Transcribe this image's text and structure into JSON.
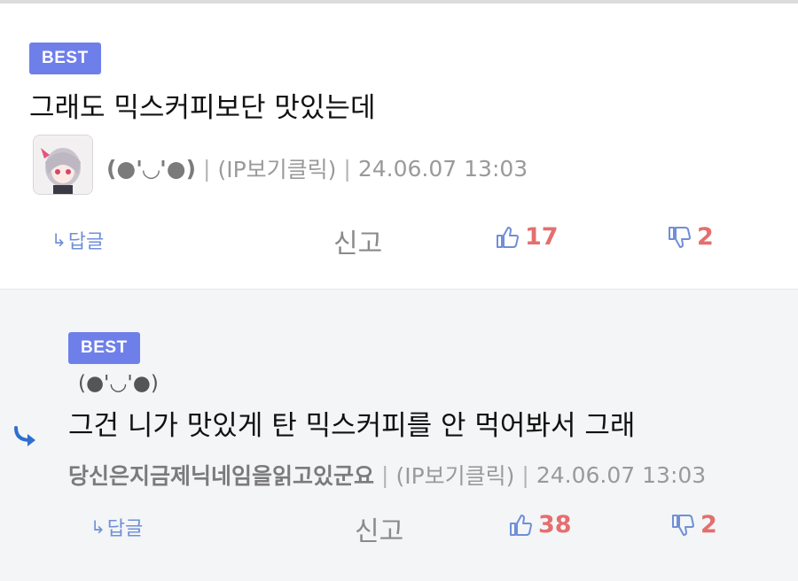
{
  "comments": [
    {
      "badge": "BEST",
      "text": "그래도 믹스커피보단 맛있는데",
      "nickname": "(●'◡'●)",
      "ip": "(IP보기클릭)",
      "date": "24.06.07 13:03",
      "reply_label": "답글",
      "report_label": "신고",
      "likes": "17",
      "dislikes": "2"
    },
    {
      "badge": "BEST",
      "reply_to": "(●'◡'●)",
      "text": "그건 니가 맛있게 탄 믹스커피를 안 먹어봐서 그래",
      "nickname": "당신은지금제닉네임을읽고있군요",
      "ip": "(IP보기클릭)",
      "date": "24.06.07 13:03",
      "reply_label": "답글",
      "report_label": "신고",
      "likes": "38",
      "dislikes": "2"
    }
  ],
  "colors": {
    "badge": "#6f7fea",
    "vote_count": "#e46f6f",
    "icon_blue": "#6f8fd8"
  }
}
